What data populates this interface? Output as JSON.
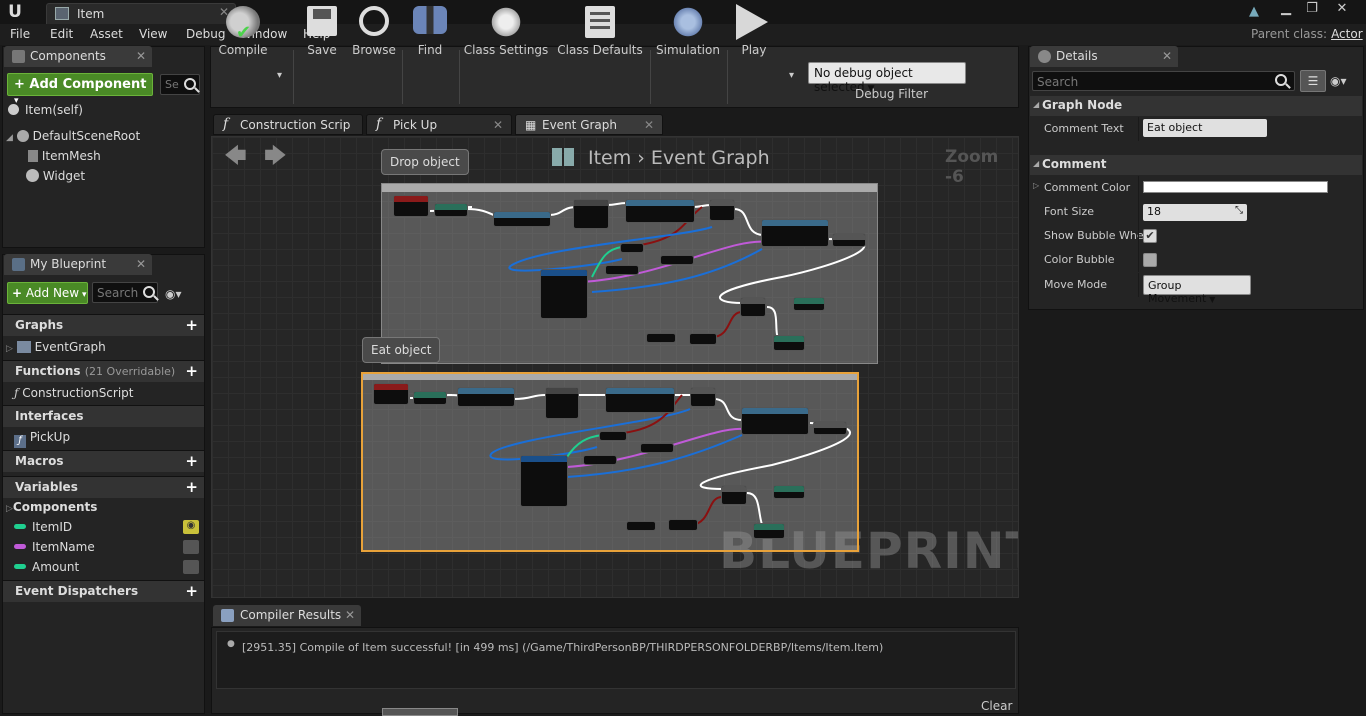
{
  "window": {
    "tab_title": "Item",
    "parent_class_label": "Parent class:",
    "parent_class_value": "Actor"
  },
  "menu": [
    "File",
    "Edit",
    "Asset",
    "View",
    "Debug",
    "Window",
    "Help"
  ],
  "components_panel": {
    "title": "Components",
    "add_button": "+ Add Component",
    "search_placeholder": "Se",
    "self_item": "Item(self)",
    "tree": [
      "DefaultSceneRoot",
      "ItemMesh",
      "Widget"
    ]
  },
  "my_blueprint": {
    "title": "My Blueprint",
    "add_button": "Add New",
    "search_placeholder": "Search",
    "graphs_label": "Graphs",
    "graphs": [
      "EventGraph"
    ],
    "functions_label": "Functions",
    "functions_count": "(21 Overridable)",
    "functions": [
      "ConstructionScript"
    ],
    "interfaces_label": "Interfaces",
    "interfaces": [
      "PickUp"
    ],
    "macros_label": "Macros",
    "variables_label": "Variables",
    "components_label": "Components",
    "variables": [
      {
        "name": "ItemID",
        "color": "#1fcf8f"
      },
      {
        "name": "ItemName",
        "color": "#c05ad8"
      },
      {
        "name": "Amount",
        "color": "#1fcf8f"
      }
    ],
    "dispatchers_label": "Event Dispatchers"
  },
  "toolbar": {
    "compile": "Compile",
    "save": "Save",
    "browse": "Browse",
    "find": "Find",
    "class_settings": "Class Settings",
    "class_defaults": "Class Defaults",
    "simulation": "Simulation",
    "play": "Play",
    "debug_select": "No debug object selected",
    "debug_filter": "Debug Filter"
  },
  "graph_tabs": [
    {
      "label": "Construction Scrip",
      "active": false
    },
    {
      "label": "Pick Up",
      "active": false
    },
    {
      "label": "Event Graph",
      "active": true
    }
  ],
  "graph": {
    "breadcrumb_root": "Item",
    "breadcrumb_leaf": "Event Graph",
    "zoom": "Zoom -6",
    "watermark": "BLUEPRINT",
    "comment1": "Drop object",
    "comment2": "Eat object"
  },
  "details": {
    "title": "Details",
    "search_placeholder": "Search",
    "graph_node_section": "Graph Node",
    "comment_text_label": "Comment Text",
    "comment_text_value": "Eat object",
    "comment_section": "Comment",
    "comment_color_label": "Comment Color",
    "comment_color_value": "#ffffff",
    "font_size_label": "Font Size",
    "font_size_value": "18",
    "show_bubble_label": "Show Bubble When",
    "show_bubble_checked": true,
    "color_bubble_label": "Color Bubble",
    "color_bubble_checked": false,
    "move_mode_label": "Move Mode",
    "move_mode_value": "Group Movement"
  },
  "compiler": {
    "title": "Compiler Results",
    "message": "[2951.35] Compile of Item successful! [in 499 ms] (/Game/ThirdPersonBP/THIRDPERSONFOLDERBP/Items/Item.Item)",
    "clear": "Clear"
  },
  "colors": {
    "accent_green": "#4a8a26",
    "comment_selected_border": "#e8a23a",
    "exec_wire": "#ffffff",
    "bool_wire": "#8a1010",
    "int_wire": "#1fcf8f",
    "string_wire": "#c05ad8",
    "struct_wire": "#1a6fd8"
  }
}
